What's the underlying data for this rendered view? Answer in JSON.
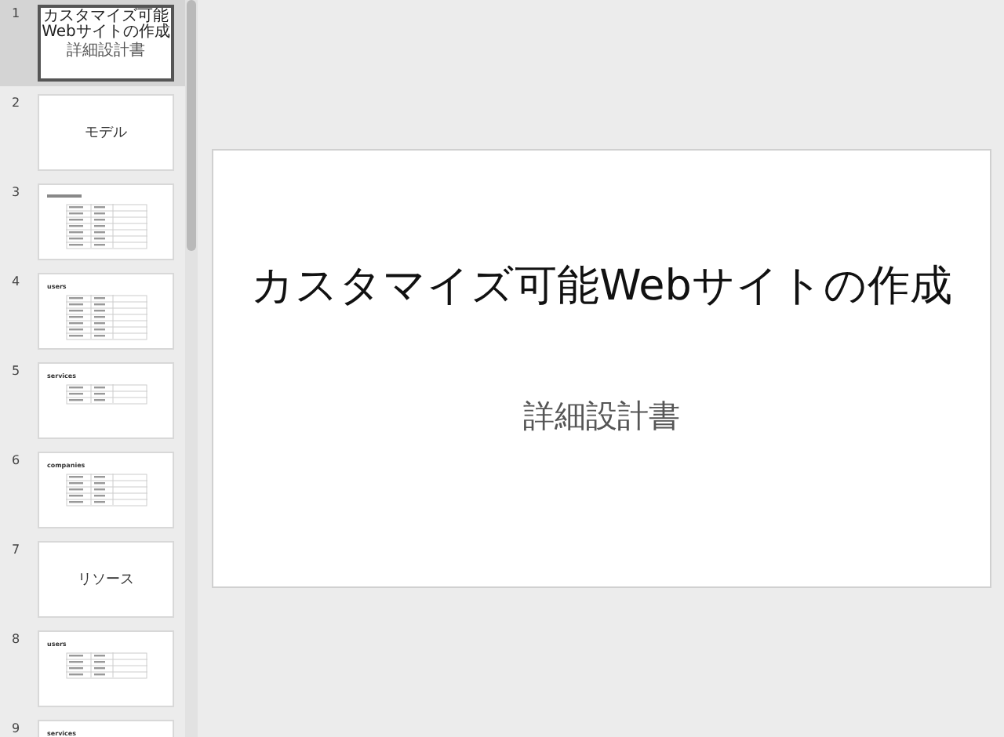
{
  "slides": [
    {
      "number": "1",
      "selected": true,
      "kind": "title",
      "title": "カスタマイズ可能Webサイトの作成",
      "subtitle": "詳細設計書"
    },
    {
      "number": "2",
      "selected": false,
      "kind": "section",
      "title": "モデル"
    },
    {
      "number": "3",
      "selected": false,
      "kind": "table"
    },
    {
      "number": "4",
      "selected": false,
      "kind": "table",
      "title": "users"
    },
    {
      "number": "5",
      "selected": false,
      "kind": "table",
      "title": "services"
    },
    {
      "number": "6",
      "selected": false,
      "kind": "table",
      "title": "companies"
    },
    {
      "number": "7",
      "selected": false,
      "kind": "section",
      "title": "リソース"
    },
    {
      "number": "8",
      "selected": false,
      "kind": "table",
      "title": "users"
    },
    {
      "number": "9",
      "selected": false,
      "kind": "heading",
      "title": "services"
    }
  ],
  "current_slide": {
    "title": "カスタマイズ可能Webサイトの作成",
    "subtitle": "詳細設計書"
  }
}
